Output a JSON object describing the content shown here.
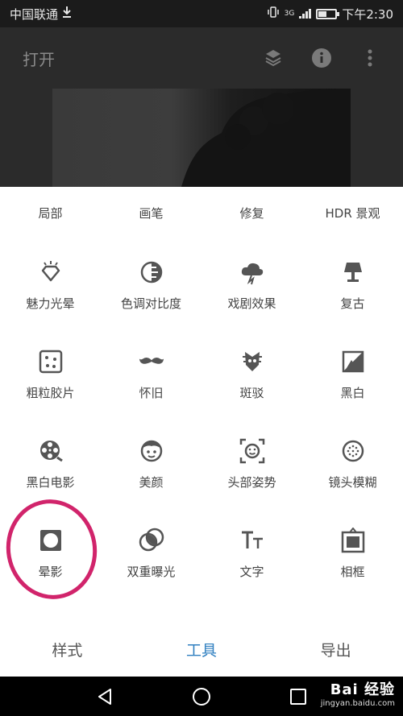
{
  "status_bar": {
    "carrier": "中国联通",
    "network": "3G",
    "time": "下午2:30",
    "battery_level": 0.45
  },
  "header": {
    "title": "打开",
    "icons": [
      "layers-icon",
      "info-icon",
      "more-vert-icon"
    ]
  },
  "tools": [
    {
      "label": "局部",
      "icon": "selective-icon"
    },
    {
      "label": "画笔",
      "icon": "brush-icon"
    },
    {
      "label": "修复",
      "icon": "healing-icon"
    },
    {
      "label": "HDR 景观",
      "icon": "hdr-icon"
    },
    {
      "label": "魅力光晕",
      "icon": "glamour-glow-icon"
    },
    {
      "label": "色调对比度",
      "icon": "tonal-contrast-icon"
    },
    {
      "label": "戏剧效果",
      "icon": "drama-icon"
    },
    {
      "label": "复古",
      "icon": "vintage-lamp-icon"
    },
    {
      "label": "粗粒胶片",
      "icon": "grainy-film-icon"
    },
    {
      "label": "怀旧",
      "icon": "mustache-icon"
    },
    {
      "label": "斑驳",
      "icon": "grunge-icon"
    },
    {
      "label": "黑白",
      "icon": "black-white-icon"
    },
    {
      "label": "黑白电影",
      "icon": "film-reel-icon"
    },
    {
      "label": "美颜",
      "icon": "face-icon"
    },
    {
      "label": "头部姿势",
      "icon": "head-pose-icon"
    },
    {
      "label": "镜头模糊",
      "icon": "lens-blur-icon"
    },
    {
      "label": "晕影",
      "icon": "vignette-icon"
    },
    {
      "label": "双重曝光",
      "icon": "double-exposure-icon"
    },
    {
      "label": "文字",
      "icon": "text-icon"
    },
    {
      "label": "相框",
      "icon": "frame-icon"
    }
  ],
  "tabs": [
    {
      "label": "样式",
      "active": false
    },
    {
      "label": "工具",
      "active": true
    },
    {
      "label": "导出",
      "active": false
    }
  ],
  "colors": {
    "accent": "#2f7fc0",
    "highlight": "#d1246b"
  },
  "watermark": {
    "main": "Bai 经验",
    "sub": "jingyan.baidu.com"
  }
}
